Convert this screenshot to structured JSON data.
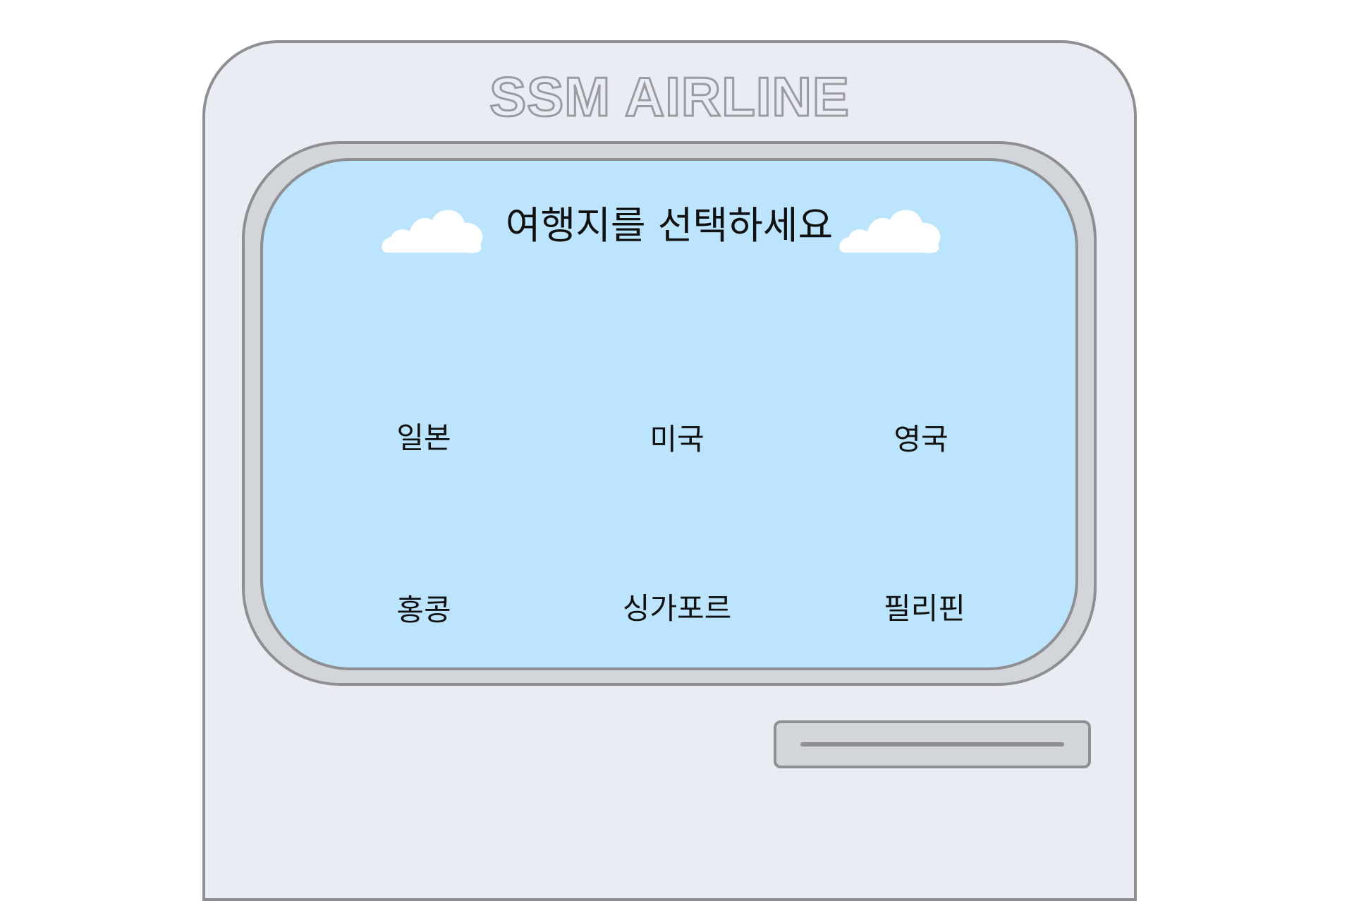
{
  "kiosk": {
    "brand": "SSM AIRLINE"
  },
  "screen": {
    "prompt": "여행지를 선택하세요",
    "destinations": [
      {
        "label": "일본"
      },
      {
        "label": "미국"
      },
      {
        "label": "영국"
      },
      {
        "label": "홍콩"
      },
      {
        "label": "싱가포르"
      },
      {
        "label": "필리핀"
      }
    ]
  },
  "icons": {
    "left_cloud": "cloud-icon",
    "right_cloud": "cloud-icon",
    "card_slot": "card-slot"
  },
  "colors": {
    "body": "#e9edf3",
    "screen": "#bce4fd",
    "frame": "#d2d6db",
    "outline": "#8e8e93"
  }
}
